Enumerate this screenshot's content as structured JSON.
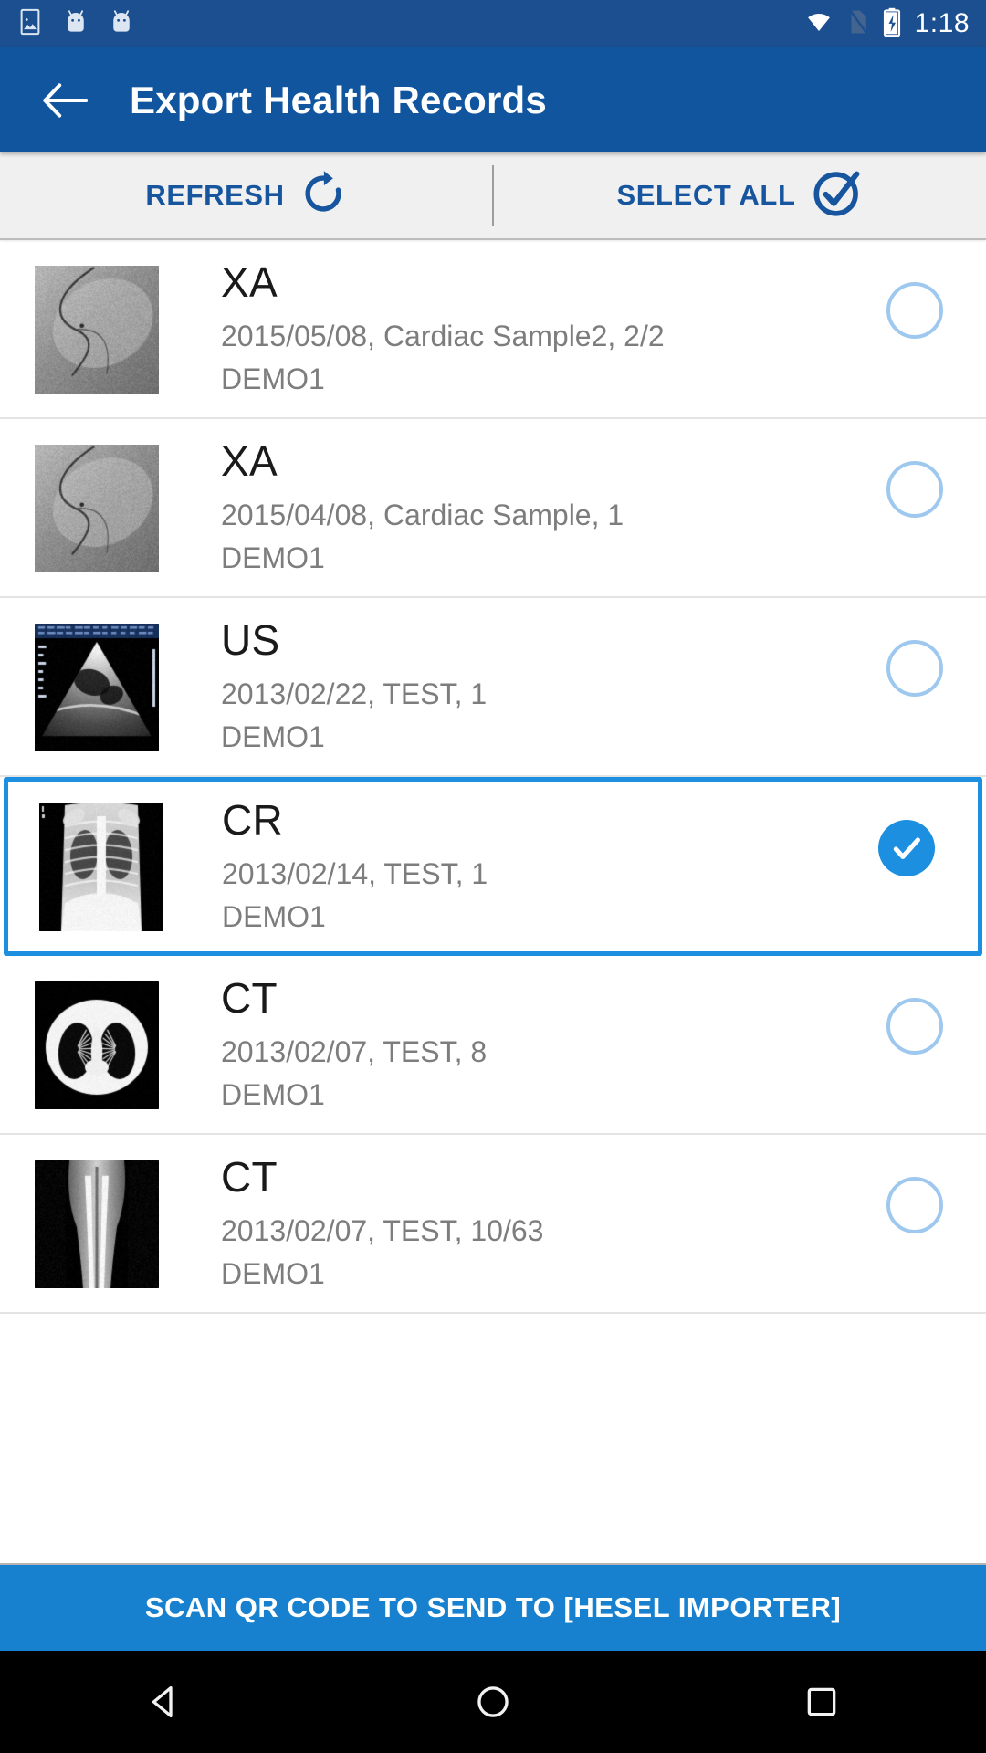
{
  "statusbar": {
    "time": "1:18",
    "left_icons": [
      "screenshot-icon",
      "android-bugdroid-icon",
      "android-bugdroid-icon"
    ],
    "right_icons": [
      "wifi-icon",
      "no-sim-icon",
      "battery-charging-icon"
    ],
    "background": "#1b4f8f"
  },
  "appbar": {
    "back_icon": "back-arrow-icon",
    "title": "Export Health Records",
    "background": "#11559f"
  },
  "actionbar": {
    "background": "#f0f0f0",
    "accent": "#17559e",
    "buttons": [
      {
        "label": "REFRESH",
        "icon": "refresh-icon"
      },
      {
        "label": "SELECT ALL",
        "icon": "check-circle-icon"
      }
    ]
  },
  "list": {
    "selected_color": "#1d8fe0",
    "unchecked_color": "#9ec8ee",
    "rows": [
      {
        "modality": "XA",
        "detail": "2015/05/08, Cardiac Sample2, 2/2",
        "patient": "DEMO1",
        "selected": false,
        "thumb": "angiography-thumbnail"
      },
      {
        "modality": "XA",
        "detail": "2015/04/08, Cardiac Sample, 1",
        "patient": "DEMO1",
        "selected": false,
        "thumb": "angiography-thumbnail"
      },
      {
        "modality": "US",
        "detail": "2013/02/22, TEST, 1",
        "patient": "DEMO1",
        "selected": false,
        "thumb": "ultrasound-thumbnail"
      },
      {
        "modality": "CR",
        "detail": "2013/02/14, TEST, 1",
        "patient": "DEMO1",
        "selected": true,
        "thumb": "chest-xray-thumbnail"
      },
      {
        "modality": "CT",
        "detail": "2013/02/07, TEST, 8",
        "patient": "DEMO1",
        "selected": false,
        "thumb": "ct-chest-thumbnail"
      },
      {
        "modality": "CT",
        "detail": "2013/02/07, TEST, 10/63",
        "patient": "DEMO1",
        "selected": false,
        "thumb": "ct-legs-thumbnail"
      }
    ]
  },
  "bottombar": {
    "label": "SCAN QR CODE TO SEND TO [HESEL IMPORTER]",
    "background": "#1780cf"
  },
  "navbar": {
    "buttons": [
      "back-nav-icon",
      "home-nav-icon",
      "recents-nav-icon"
    ],
    "background": "#000000"
  }
}
